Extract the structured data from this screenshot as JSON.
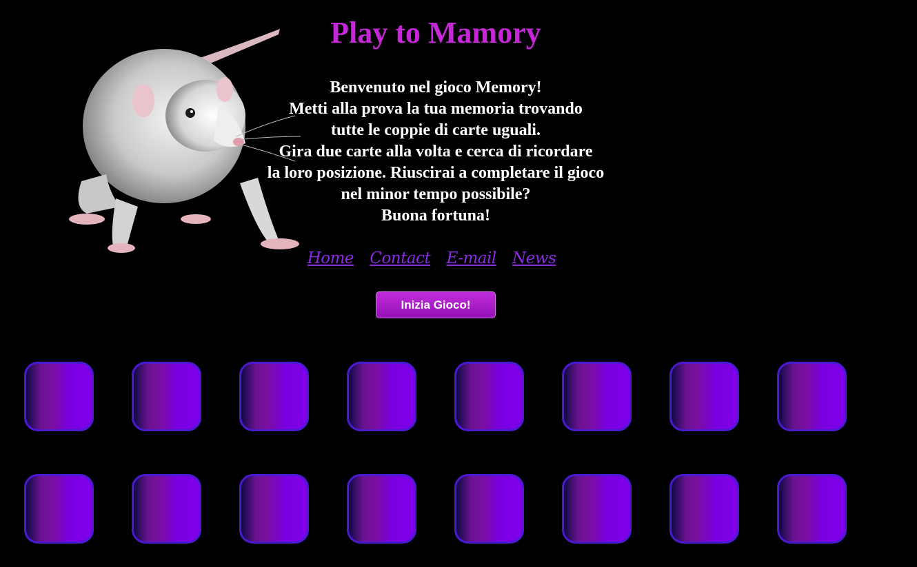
{
  "header": {
    "title": "Play to Mamory"
  },
  "hero_image": {
    "subject": "white rat"
  },
  "intro_lines": [
    "Benvenuto nel gioco Memory!",
    "Metti alla prova la tua memoria trovando",
    "tutte le coppie di carte uguali.",
    "Gira due carte alla volta e cerca di ricordare",
    "la loro posizione. Riuscirai a completare il gioco",
    "nel minor tempo possibile?",
    "Buona fortuna!"
  ],
  "nav": {
    "items": [
      {
        "label": "Home"
      },
      {
        "label": "Contact"
      },
      {
        "label": "E-mail"
      },
      {
        "label": "News"
      }
    ]
  },
  "start_button": {
    "label": "Inizia Gioco!"
  },
  "board": {
    "rows": 2,
    "columns": 8,
    "card_count": 16,
    "card_state": "face-down"
  },
  "colors": {
    "background": "#000000",
    "title": "#c327d6",
    "nav_link": "#8a2be2",
    "button": "#b520d0",
    "card_border": "#4a1ad0",
    "card_face": "#8000ea"
  }
}
